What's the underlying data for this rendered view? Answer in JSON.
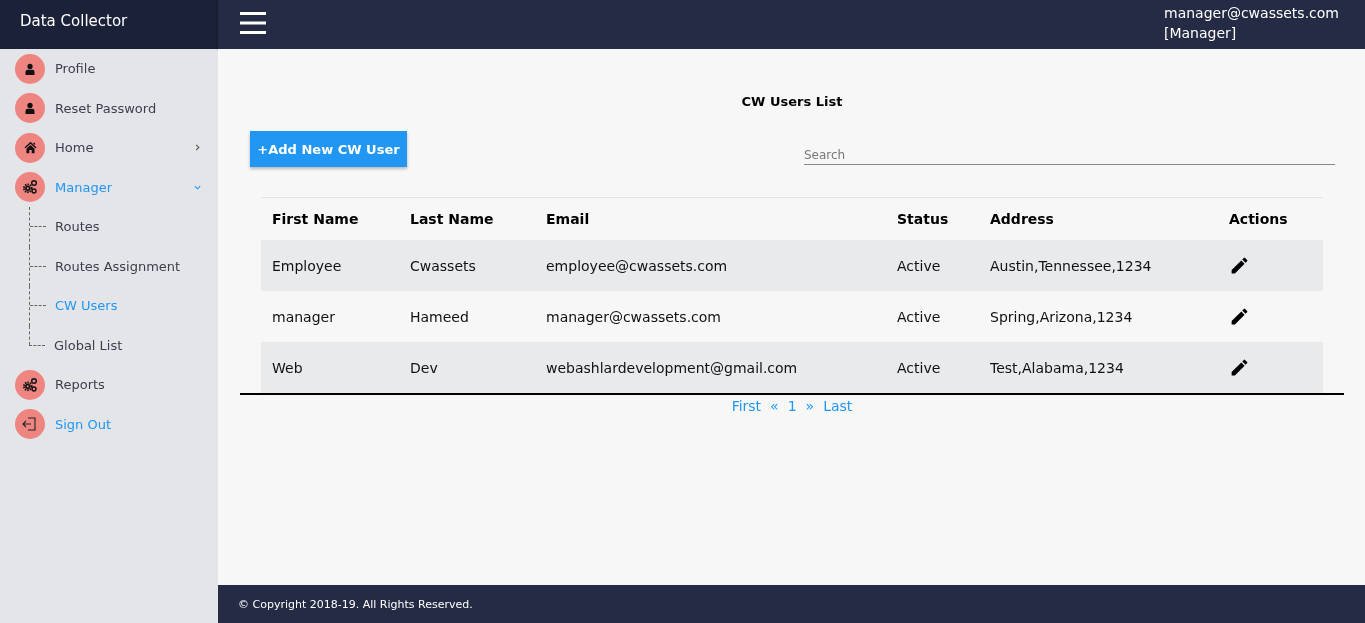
{
  "app_title": "Data Collector",
  "user": {
    "email": "manager@cwassets.com",
    "role": "[Manager]"
  },
  "sidebar": {
    "items": [
      {
        "label": "Profile",
        "kind": "person",
        "highlighted": false
      },
      {
        "label": "Reset Password",
        "kind": "person",
        "highlighted": false
      },
      {
        "label": "Home",
        "kind": "home",
        "highlighted": false,
        "expanded": false
      },
      {
        "label": "Manager",
        "kind": "gears",
        "highlighted": true,
        "expanded": true,
        "children": [
          {
            "label": "Routes",
            "selected": false
          },
          {
            "label": "Routes Assignment",
            "selected": false
          },
          {
            "label": "CW Users",
            "selected": true
          },
          {
            "label": "Global List",
            "selected": false
          }
        ]
      },
      {
        "label": "Reports",
        "kind": "gears",
        "highlighted": false
      },
      {
        "label": "Sign Out",
        "kind": "exit",
        "highlighted": true
      }
    ]
  },
  "page_title": "CW Users List",
  "add_button": "+Add New CW User",
  "search": {
    "placeholder": "Search"
  },
  "table": {
    "columns": [
      "First Name",
      "Last Name",
      "Email",
      "Status",
      "Address",
      "Actions"
    ],
    "rows": [
      {
        "cells": [
          "Employee",
          "Cwassets",
          "employee@cwassets.com",
          "Active",
          "Austin,Tennessee,1234"
        ]
      },
      {
        "cells": [
          "manager",
          "Hameed",
          "manager@cwassets.com",
          "Active",
          "Spring,Arizona,1234"
        ]
      },
      {
        "cells": [
          "Web",
          "Dev",
          "webashlardevelopment@gmail.com",
          "Active",
          "Test,Alabama,1234"
        ]
      }
    ]
  },
  "pagination": [
    "First",
    "«",
    "1",
    "»",
    "Last"
  ],
  "footer": "© Copyright 2018-19. All Rights Reserved."
}
